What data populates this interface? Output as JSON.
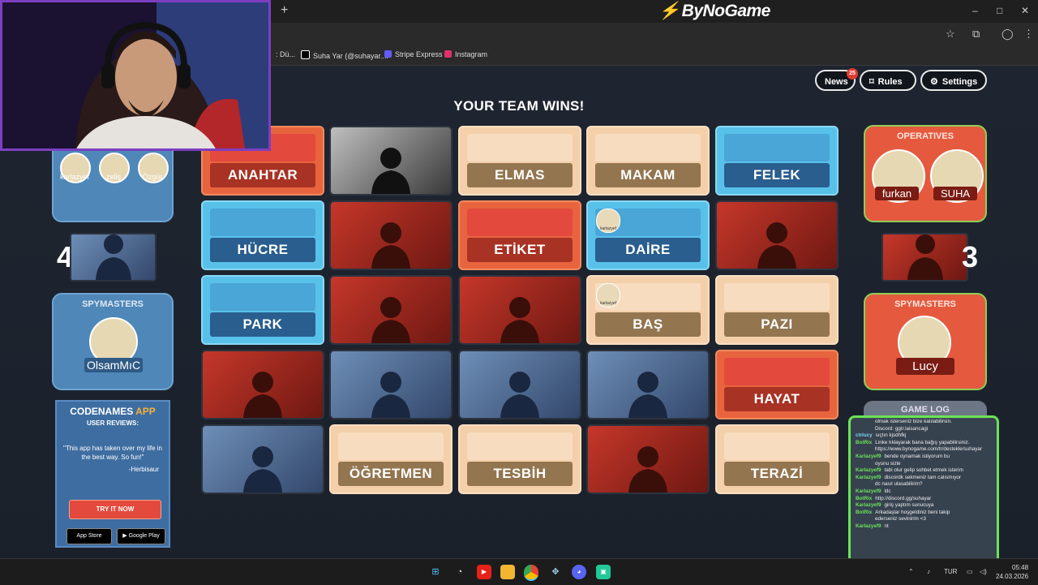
{
  "browser": {
    "new_tab": "+",
    "site_logo": "ByNoGame",
    "window_controls": [
      "–",
      "□",
      "✕"
    ],
    "bookmarks": [
      {
        "label": ": Dü...",
        "color": "#555555"
      },
      {
        "label": "Suha Yar (@suhayar....",
        "color": "#000000"
      },
      {
        "label": "Stripe Express",
        "color": "#635bff"
      },
      {
        "label": "Instagram",
        "color": "#e1306c"
      }
    ]
  },
  "header": {
    "news_label": "News",
    "news_count": "25",
    "rules_label": "Rules",
    "settings_label": "Settings"
  },
  "status": "YOUR TEAM WINS!",
  "board": [
    {
      "word": "ANAHTAR",
      "type": "red"
    },
    {
      "word": "",
      "type": "agent-black"
    },
    {
      "word": "ELMAS",
      "type": "neutral"
    },
    {
      "word": "MAKAM",
      "type": "neutral"
    },
    {
      "word": "FELEK",
      "type": "blue"
    },
    {
      "word": "HÜCRE",
      "type": "blue"
    },
    {
      "word": "",
      "type": "agent-red"
    },
    {
      "word": "ETİKET",
      "type": "red"
    },
    {
      "word": "DAİRE",
      "type": "blue",
      "marker": "karlazyef"
    },
    {
      "word": "",
      "type": "agent-red"
    },
    {
      "word": "PARK",
      "type": "blue"
    },
    {
      "word": "",
      "type": "agent-red"
    },
    {
      "word": "",
      "type": "agent-red"
    },
    {
      "word": "BAŞ",
      "type": "neutral",
      "marker": "karlazyef"
    },
    {
      "word": "PAZI",
      "type": "neutral"
    },
    {
      "word": "",
      "type": "agent-red"
    },
    {
      "word": "",
      "type": "agent-blue"
    },
    {
      "word": "",
      "type": "agent-blue"
    },
    {
      "word": "",
      "type": "agent-blue"
    },
    {
      "word": "HAYAT",
      "type": "red"
    },
    {
      "word": "",
      "type": "agent-blue"
    },
    {
      "word": "ÖĞRETMEN",
      "type": "neutral"
    },
    {
      "word": "TESBİH",
      "type": "neutral"
    },
    {
      "word": "",
      "type": "agent-red"
    },
    {
      "word": "TERAZİ",
      "type": "neutral"
    }
  ],
  "blue_team": {
    "operatives": [
      "karlazyef",
      "zeliş",
      "Özgür"
    ],
    "score": "4",
    "spymasters_title": "SPYMASTERS",
    "spymaster": "OlsamMıC"
  },
  "red_team": {
    "operatives_title": "OPERATIVES",
    "operatives": [
      "furkan",
      "SUHA"
    ],
    "score": "3",
    "spymasters_title": "SPYMASTERS",
    "spymaster": "Lucy"
  },
  "ad": {
    "title_main": "CODENAMES ",
    "title_accent": "APP",
    "subtitle": "USER REVIEWS:",
    "quote": "\"This app has taken over my life in the best way. So fun!\"",
    "author": "-Herbisaur",
    "cta": "TRY IT NOW",
    "app_store": "App Store",
    "google_play": "Google Play"
  },
  "game_log_title": "GAME LOG",
  "chat": [
    {
      "user": "",
      "text": "olmak isterseniz bize katılabilirsin.",
      "color": "#eeeeee"
    },
    {
      "user": "",
      "text": "Discord: ggtr.laisancagi",
      "color": "#eeeeee"
    },
    {
      "user": "ctrlucy",
      "text": "sıçtın kjsdhfkj",
      "color": "#7ad7f0"
    },
    {
      "user": "BotRix",
      "text": "Linke tıklayarak bana bağış yapabilirsiniz.",
      "color": "#6be357"
    },
    {
      "user": "",
      "text": "https://www.bynogame.com/tr/destekle/suhayar",
      "color": "#eeeeee"
    },
    {
      "user": "Karlazyef9",
      "text": "bende oynamak istiyorum bu",
      "color": "#6be357"
    },
    {
      "user": "",
      "text": "oyunu sizle",
      "color": "#eeeeee"
    },
    {
      "user": "Karlazyef9",
      "text": "tabi olur gelip sohbet etmek isterim",
      "color": "#6be357"
    },
    {
      "user": "Karlazyef9",
      "text": "discordk sekmeniz tam calısmıyor",
      "color": "#6be357"
    },
    {
      "user": "",
      "text": "dc nasıl ulasabilirim?",
      "color": "#eeeeee"
    },
    {
      "user": "Karlazyef9",
      "text": "ldc",
      "color": "#6be357"
    },
    {
      "user": "BotRix",
      "text": "http://discord.gg/suhayar",
      "color": "#6be357"
    },
    {
      "user": "Karlazyef9",
      "text": "giriş yaptım sunucuya",
      "color": "#6be357"
    },
    {
      "user": "BotRix",
      "text": "Arkadaşlar hoşgeldiniz beni takip",
      "color": "#6be357"
    },
    {
      "user": "",
      "text": "ederseniz sevinirim <3",
      "color": "#eeeeee"
    },
    {
      "user": "Karlazyef9",
      "text": "nt",
      "color": "#6be357"
    }
  ],
  "taskbar": {
    "icons": [
      "windows-icon",
      "copilot-icon",
      "youtube-icon",
      "folder-icon",
      "chrome-icon",
      "app-icon",
      "discord-icon",
      "app2-icon"
    ],
    "lang": "TUR",
    "time": "05:48",
    "date": "24.03.2026"
  }
}
